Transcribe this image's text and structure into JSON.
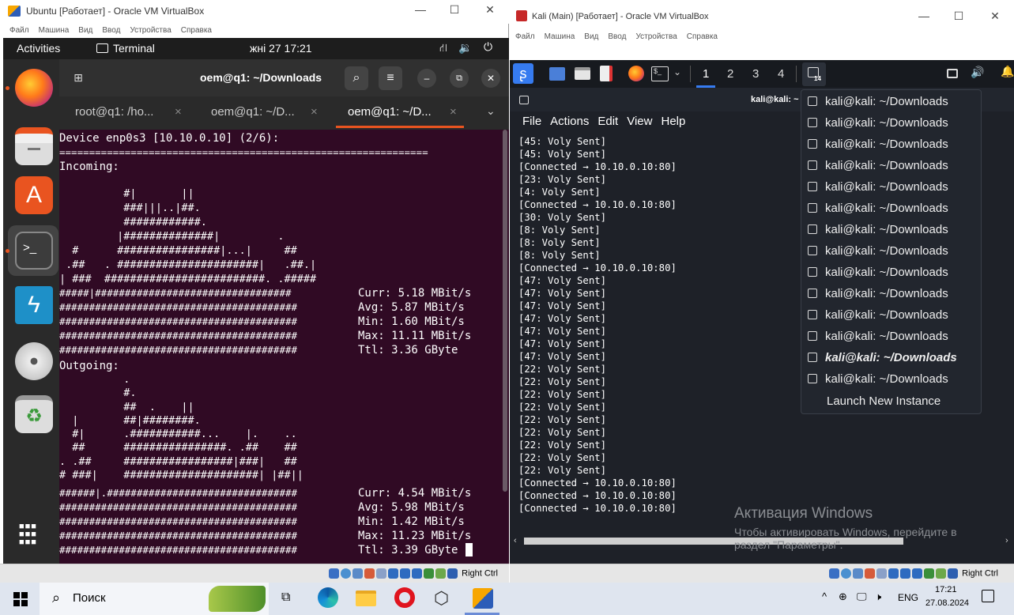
{
  "ubuntu_window": {
    "title": "Ubuntu [Работает] - Oracle VM VirtualBox",
    "menu": [
      "Файл",
      "Машина",
      "Вид",
      "Ввод",
      "Устройства",
      "Справка"
    ],
    "topbar": {
      "activities": "Activities",
      "app": "Terminal",
      "clock": "жні 27  17:21"
    },
    "terminal": {
      "title": "oem@q1: ~/Downloads",
      "tabs": [
        {
          "label": "root@q1: /ho...",
          "active": false
        },
        {
          "label": "oem@q1: ~/D...",
          "active": false
        },
        {
          "label": "oem@q1: ~/D...",
          "active": true
        }
      ],
      "device_line": "Device enp0s3 [10.10.0.10] (2/6):",
      "separator": "==============================================================",
      "incoming_label": "Incoming:",
      "incoming_graph": [
        "          #|       ||",
        "          ###|||..|##.",
        "          ############.",
        "         |##############|         .",
        "  #      ################|...|     ##",
        " .##   . ######################|   .##.|",
        "| ###  #########################. .#####"
      ],
      "incoming_stats_graph": [
        "#####|#################################",
        "########################################",
        "########################################",
        "########################################",
        "########################################"
      ],
      "incoming_stats": [
        "Curr: 5.18 MBit/s",
        "Avg: 5.87 MBit/s",
        "Min: 1.60 MBit/s",
        "Max: 11.11 MBit/s",
        "Ttl: 3.36 GByte"
      ],
      "outgoing_label": "Outgoing:",
      "outgoing_graph": [
        "          .",
        "          #.",
        "          ##  .    ||",
        "  |       ##|########.",
        "  #|      .###########...    |.    ..",
        "  ##      ################. .##    ##",
        ". .##     #################|###|   ##",
        "# ###|    #####################| |##||"
      ],
      "outgoing_stats_graph": [
        "######|.################################",
        "########################################",
        "########################################",
        "########################################",
        "########################################"
      ],
      "outgoing_stats": [
        "Curr: 4.54 MBit/s",
        "Avg: 5.98 MBit/s",
        "Min: 1.42 MBit/s",
        "Max: 11.23 MBit/s",
        "Ttl: 3.39 GByte"
      ]
    },
    "status_host_key": "Right Ctrl"
  },
  "kali_window": {
    "title": "Kali (Main) [Работает] - Oracle VM VirtualBox",
    "menu": [
      "Файл",
      "Машина",
      "Вид",
      "Ввод",
      "Устройства",
      "Справка"
    ],
    "workspaces": [
      "1",
      "2",
      "3",
      "4"
    ],
    "taskbar_badge": "14",
    "term_title": "kali@kali: ~",
    "term_menu": [
      "File",
      "Actions",
      "Edit",
      "View",
      "Help"
    ],
    "output_lines": [
      "[45: Voly Sent]",
      "[45: Voly Sent]",
      "[Connected → 10.10.0.10:80]",
      "[23: Voly Sent]",
      "[4: Voly Sent]",
      "[Connected → 10.10.0.10:80]",
      "[30: Voly Sent]",
      "[8: Voly Sent]",
      "[8: Voly Sent]",
      "[8: Voly Sent]",
      "[Connected → 10.10.0.10:80]",
      "[47: Voly Sent]",
      "[47: Voly Sent]",
      "[47: Voly Sent]",
      "[47: Voly Sent]",
      "[47: Voly Sent]",
      "[47: Voly Sent]",
      "[47: Voly Sent]",
      "[22: Voly Sent]",
      "[22: Voly Sent]",
      "[22: Voly Sent]",
      "[22: Voly Sent]",
      "[22: Voly Sent]",
      "[22: Voly Sent]",
      "[22: Voly Sent]",
      "[22: Voly Sent]",
      "[22: Voly Sent]",
      "[Connected → 10.10.0.10:80]",
      "[Connected → 10.10.0.10:80]",
      "[Connected → 10.10.0.10:80]"
    ],
    "window_list": [
      "kali@kali: ~/Downloads",
      "kali@kali: ~/Downloads",
      "kali@kali: ~/Downloads",
      "kali@kali: ~/Downloads",
      "kali@kali: ~/Downloads",
      "kali@kali: ~/Downloads",
      "kali@kali: ~/Downloads",
      "kali@kali: ~/Downloads",
      "kali@kali: ~/Downloads",
      "kali@kali: ~/Downloads",
      "kali@kali: ~/Downloads",
      "kali@kali: ~/Downloads",
      "kali@kali: ~/Downloads",
      "kali@kali: ~/Downloads"
    ],
    "window_list_active_index": 12,
    "launch_new": "Launch New Instance",
    "activation_title": "Активация Windows",
    "activation_text_1": "Чтобы активировать Windows, перейдите в",
    "activation_text_2": "раздел \"Параметры\".",
    "status_host_key": "Right Ctrl"
  },
  "windows_taskbar": {
    "search_placeholder": "Поиск",
    "lang": "ENG",
    "time": "17:21",
    "date": "27.08.2024"
  },
  "colors": {
    "ubuntu_terminal_bg": "#300a24",
    "ubuntu_topbar": "#1d1d1d",
    "kali_bg": "#22262e",
    "kali_panel": "#171a1f",
    "kali_accent": "#367bf0",
    "windows_taskbar": "#dfe5ef"
  }
}
